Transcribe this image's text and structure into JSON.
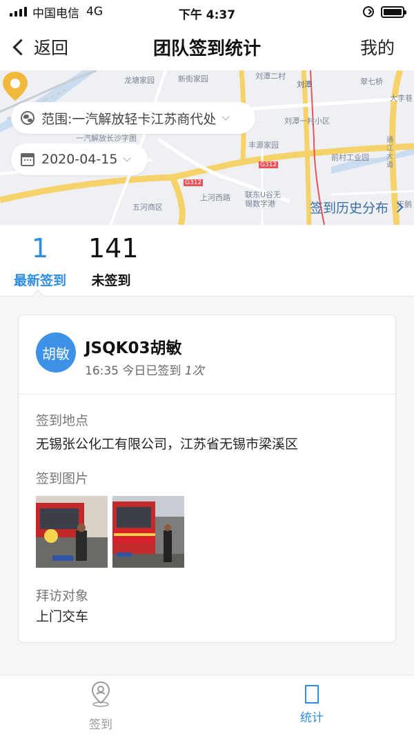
{
  "status_bar": {
    "carrier": "中国电信",
    "network": "4G",
    "time": "下午 4:37"
  },
  "nav": {
    "back_label": "返回",
    "title": "团队签到统计",
    "right_label": "我的"
  },
  "map": {
    "scope_filter": "范围:一汽解放轻卡江苏商代处",
    "date_filter": "2020-04-15",
    "history_link": "签到历史分布",
    "place_labels": [
      "龙塘家园",
      "新街家园",
      "刘潭二村",
      "刘潭",
      "一汽解放长沙字图",
      "刘潭一村小区",
      "丰源家园",
      "前村工业园",
      "五河商区",
      "上河西路",
      "联东U谷无锡数字港",
      "天鹅",
      "翠七桥",
      "大李巷",
      "通江大道",
      "G312",
      "G312"
    ]
  },
  "stats": {
    "latest_count": "1",
    "latest_label": "最新签到",
    "absent_count": "141",
    "absent_label": "未签到"
  },
  "checkin_card": {
    "avatar_text": "胡敏",
    "name": "JSQK03胡敏",
    "time": "16:35",
    "status_prefix": "今日已签到",
    "count": "1次",
    "location_label": "签到地点",
    "location_value": "无锡张公化工有限公司，江苏省无锡市梁溪区",
    "photos_label": "签到图片",
    "visit_label": "拜访对象",
    "visit_value": "上门交车"
  },
  "tab_bar": {
    "checkin_label": "签到",
    "stats_label": "统计"
  },
  "colors": {
    "accent": "#2f8de4",
    "avatar": "#3d92e8",
    "map_road_yellow": "#f6d26b",
    "pin": "#f1b93c"
  }
}
